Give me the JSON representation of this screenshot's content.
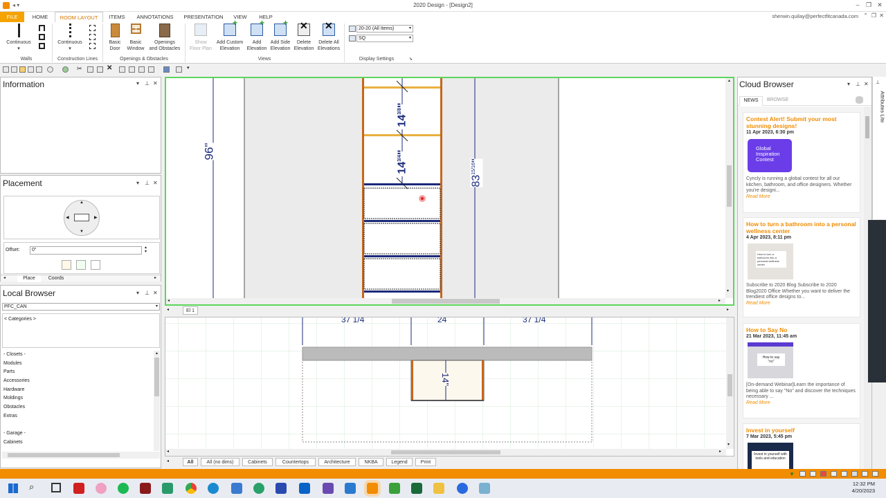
{
  "window": {
    "title": "2020 Design - [Design2]",
    "user": "sherwin.quilay@perfectfitcanada.com"
  },
  "menu": {
    "tabs": [
      "FILE",
      "HOME",
      "ROOM LAYOUT",
      "ITEMS",
      "ANNOTATIONS",
      "PRESENTATION",
      "VIEW",
      "HELP"
    ],
    "active": "ROOM LAYOUT"
  },
  "ribbon": {
    "walls": {
      "btn1": "Continuous",
      "group": "Walls"
    },
    "construction": {
      "btn1": "Continuous",
      "group": "Construction Lines"
    },
    "openings": {
      "basic_door": [
        "Basic",
        "Door"
      ],
      "basic_window": [
        "Basic",
        "Window"
      ],
      "openings_obstacles": [
        "Openings",
        "and Obstacles"
      ],
      "group": "Openings & Obstacles"
    },
    "views": {
      "show_floor_plan": [
        "Show",
        "Floor Plan"
      ],
      "add_custom": [
        "Add Custom",
        "Elevation"
      ],
      "add_elev": [
        "Add",
        "Elevation"
      ],
      "add_side": [
        "Add Side",
        "Elevation"
      ],
      "delete_elev": [
        "Delete",
        "Elevation"
      ],
      "delete_all": [
        "Delete All",
        "Elevations"
      ],
      "group": "Views"
    },
    "display": {
      "catalog": "20-20 (All Items)",
      "unit": "SQ",
      "group": "Display Settings"
    }
  },
  "info_panel": {
    "title": "Information"
  },
  "placement_panel": {
    "title": "Placement",
    "offset_label": "Offset:",
    "offset_value": "0\"",
    "tabs": [
      "Place",
      "Coords"
    ]
  },
  "local_browser": {
    "title": "Local Browser",
    "catalog": "PFC_CAN",
    "categories_label": "< Categories >",
    "items": [
      "- Closets -",
      "Modules",
      "Parts",
      "Accessories",
      "Hardware",
      "Moldings",
      "Obstacles",
      "Extras",
      "",
      "- Garage -",
      "Cabinets"
    ]
  },
  "elevation": {
    "tab": "El 1",
    "dims": {
      "height_left": "96\"",
      "shelf1": "14",
      "shelf1_frac": "3/8",
      "shelf2": "14",
      "shelf2_frac": "3/4",
      "height_right": "83",
      "height_right_frac": "15/16"
    }
  },
  "plan": {
    "dims": {
      "left": "37 1/4",
      "mid": "24",
      "right": "37 1/4",
      "depth": "14\""
    },
    "tabs": [
      "All",
      "All (no dims)",
      "Cabinets",
      "Countertops",
      "Architecture",
      "NKBA",
      "Legend",
      "Print"
    ]
  },
  "cloud_browser": {
    "title": "Cloud Browser",
    "side_label": "Attributes Lite",
    "tabs": [
      "NEWS",
      "BROWSE"
    ],
    "cards": [
      {
        "title": "Contest Alert! Submit your most stunning designs!",
        "date": "11 Apr 2023, 6:30 pm",
        "thumb": "Global Inspiration Contest",
        "desc": "Cyncly is running a global contest for all our kitchen, bathroom, and office designers. Whether you're designi...",
        "more": "Read More"
      },
      {
        "title": "How to turn a bathroom into a personal wellness center",
        "date": "4 Apr 2023, 8:11 pm",
        "thumb": "How to turn a bathroom into a personal wellness center",
        "desc": "Subscribe to 2020 Blog Subscribe to 2020 Blog2020 Office Whether you want to deliver the trendiest office designs to...",
        "more": "Read More"
      },
      {
        "title": "How to Say No",
        "date": "21 Mar 2023, 11:45 am",
        "thumb": "How to say \"no\"",
        "desc": "[On-demand Webinar]Learn the importance of being able to say \"No\" and discover the techniques necessary ...",
        "more": "Read More"
      },
      {
        "title": "Invest in yourself",
        "date": "7 Mar 2023, 5:45 pm",
        "thumb": "Invest in yourself with tools and education",
        "desc": "",
        "more": ""
      }
    ]
  },
  "taskbar": {
    "time": "12:32 PM",
    "date": "4/20/2023"
  },
  "colors": {
    "accent": "#f28c00",
    "selection_green": "#5cd65c",
    "dim_blue": "#1a2a7a",
    "cabinet_orange": "#c8661a",
    "contest_purple": "#6a3de8"
  }
}
